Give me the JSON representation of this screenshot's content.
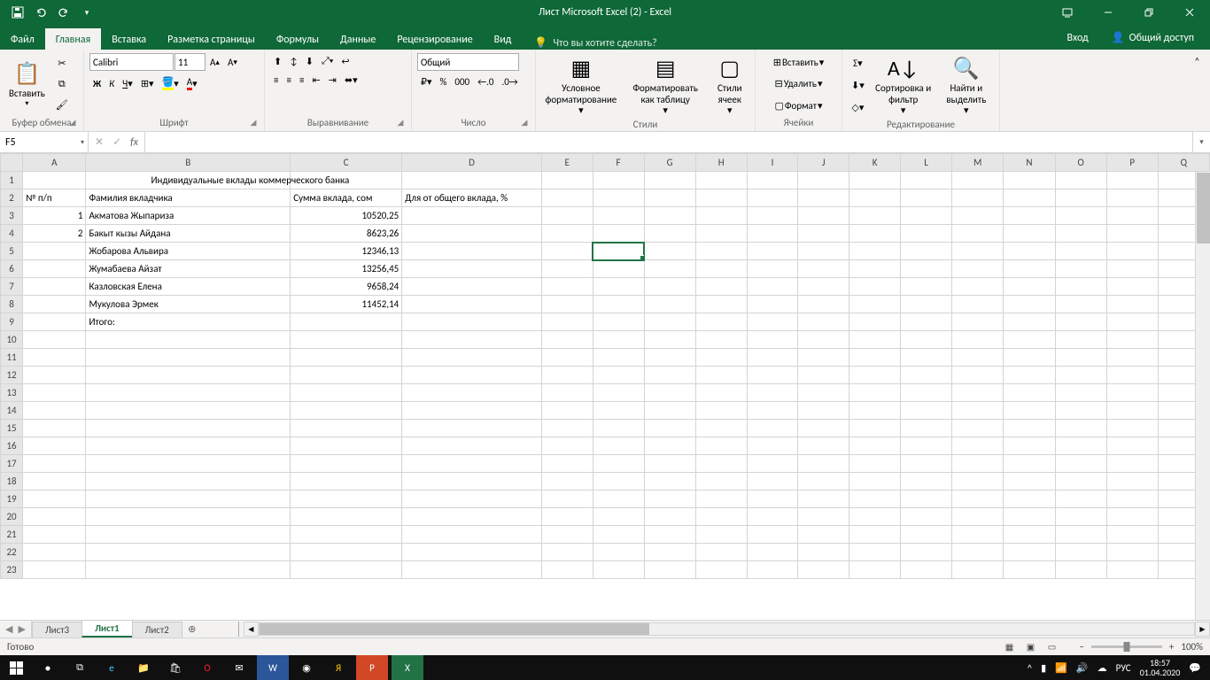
{
  "titlebar": {
    "title": "Лист Microsoft Excel (2) - Excel"
  },
  "tabs": {
    "file": "Файл",
    "items": [
      "Главная",
      "Вставка",
      "Разметка страницы",
      "Формулы",
      "Данные",
      "Рецензирование",
      "Вид"
    ],
    "active": "Главная",
    "tellme": "Что вы хотите сделать?",
    "login": "Вход",
    "share": "Общий доступ"
  },
  "ribbon": {
    "clipboard": {
      "label": "Буфер обмена",
      "paste": "Вставить"
    },
    "font": {
      "label": "Шрифт",
      "name": "Calibri",
      "size": "11"
    },
    "align": {
      "label": "Выравнивание"
    },
    "number": {
      "label": "Число",
      "format": "Общий"
    },
    "styles": {
      "label": "Стили",
      "cond": "Условное форматирование",
      "table": "Форматировать как таблицу",
      "cell": "Стили ячеек"
    },
    "cells": {
      "label": "Ячейки",
      "insert": "Вставить",
      "delete": "Удалить",
      "format": "Формат"
    },
    "editing": {
      "label": "Редактирование",
      "sort": "Сортировка и фильтр",
      "find": "Найти и выделить"
    }
  },
  "formulabar": {
    "namebox": "F5",
    "formula": ""
  },
  "grid": {
    "columns": [
      "A",
      "B",
      "C",
      "D",
      "E",
      "F",
      "G",
      "H",
      "I",
      "J",
      "K",
      "L",
      "M",
      "N",
      "O",
      "P",
      "Q"
    ],
    "selected": "F5",
    "rows": [
      {
        "n": 1,
        "cells": {
          "B": "Индивидуальные вклады коммерческого банка"
        }
      },
      {
        "n": 2,
        "cells": {
          "A": "№ п/п",
          "B": "Фамилия вкладчика",
          "C": "Сумма вклада, сом",
          "D": "Для от общего вклада, %"
        }
      },
      {
        "n": 3,
        "cells": {
          "A": "1",
          "B": "Акматова Жыпариза",
          "C": "10520,25"
        }
      },
      {
        "n": 4,
        "cells": {
          "A": "2",
          "B": "Бакыт кызы Айдана",
          "C": "8623,26"
        }
      },
      {
        "n": 5,
        "cells": {
          "B": "Жобарова Альвира",
          "C": "12346,13"
        }
      },
      {
        "n": 6,
        "cells": {
          "B": "Жумабаева Айзат",
          "C": "13256,45"
        }
      },
      {
        "n": 7,
        "cells": {
          "B": "Казловская Елена",
          "C": "9658,24"
        }
      },
      {
        "n": 8,
        "cells": {
          "B": "Мукулова Эрмек",
          "C": "11452,14"
        }
      },
      {
        "n": 9,
        "cells": {
          "B": "Итого:"
        }
      },
      {
        "n": 10
      },
      {
        "n": 11
      },
      {
        "n": 12
      },
      {
        "n": 13
      },
      {
        "n": 14
      },
      {
        "n": 15
      },
      {
        "n": 16
      },
      {
        "n": 17
      },
      {
        "n": 18
      },
      {
        "n": 19
      },
      {
        "n": 20
      },
      {
        "n": 21
      },
      {
        "n": 22
      },
      {
        "n": 23
      }
    ]
  },
  "sheets": {
    "items": [
      "Лист3",
      "Лист1",
      "Лист2"
    ],
    "active": "Лист1"
  },
  "status": {
    "ready": "Готово",
    "zoom": "100%"
  },
  "taskbar": {
    "lang": "РУС",
    "time": "18:57",
    "date": "01.04.2020"
  }
}
